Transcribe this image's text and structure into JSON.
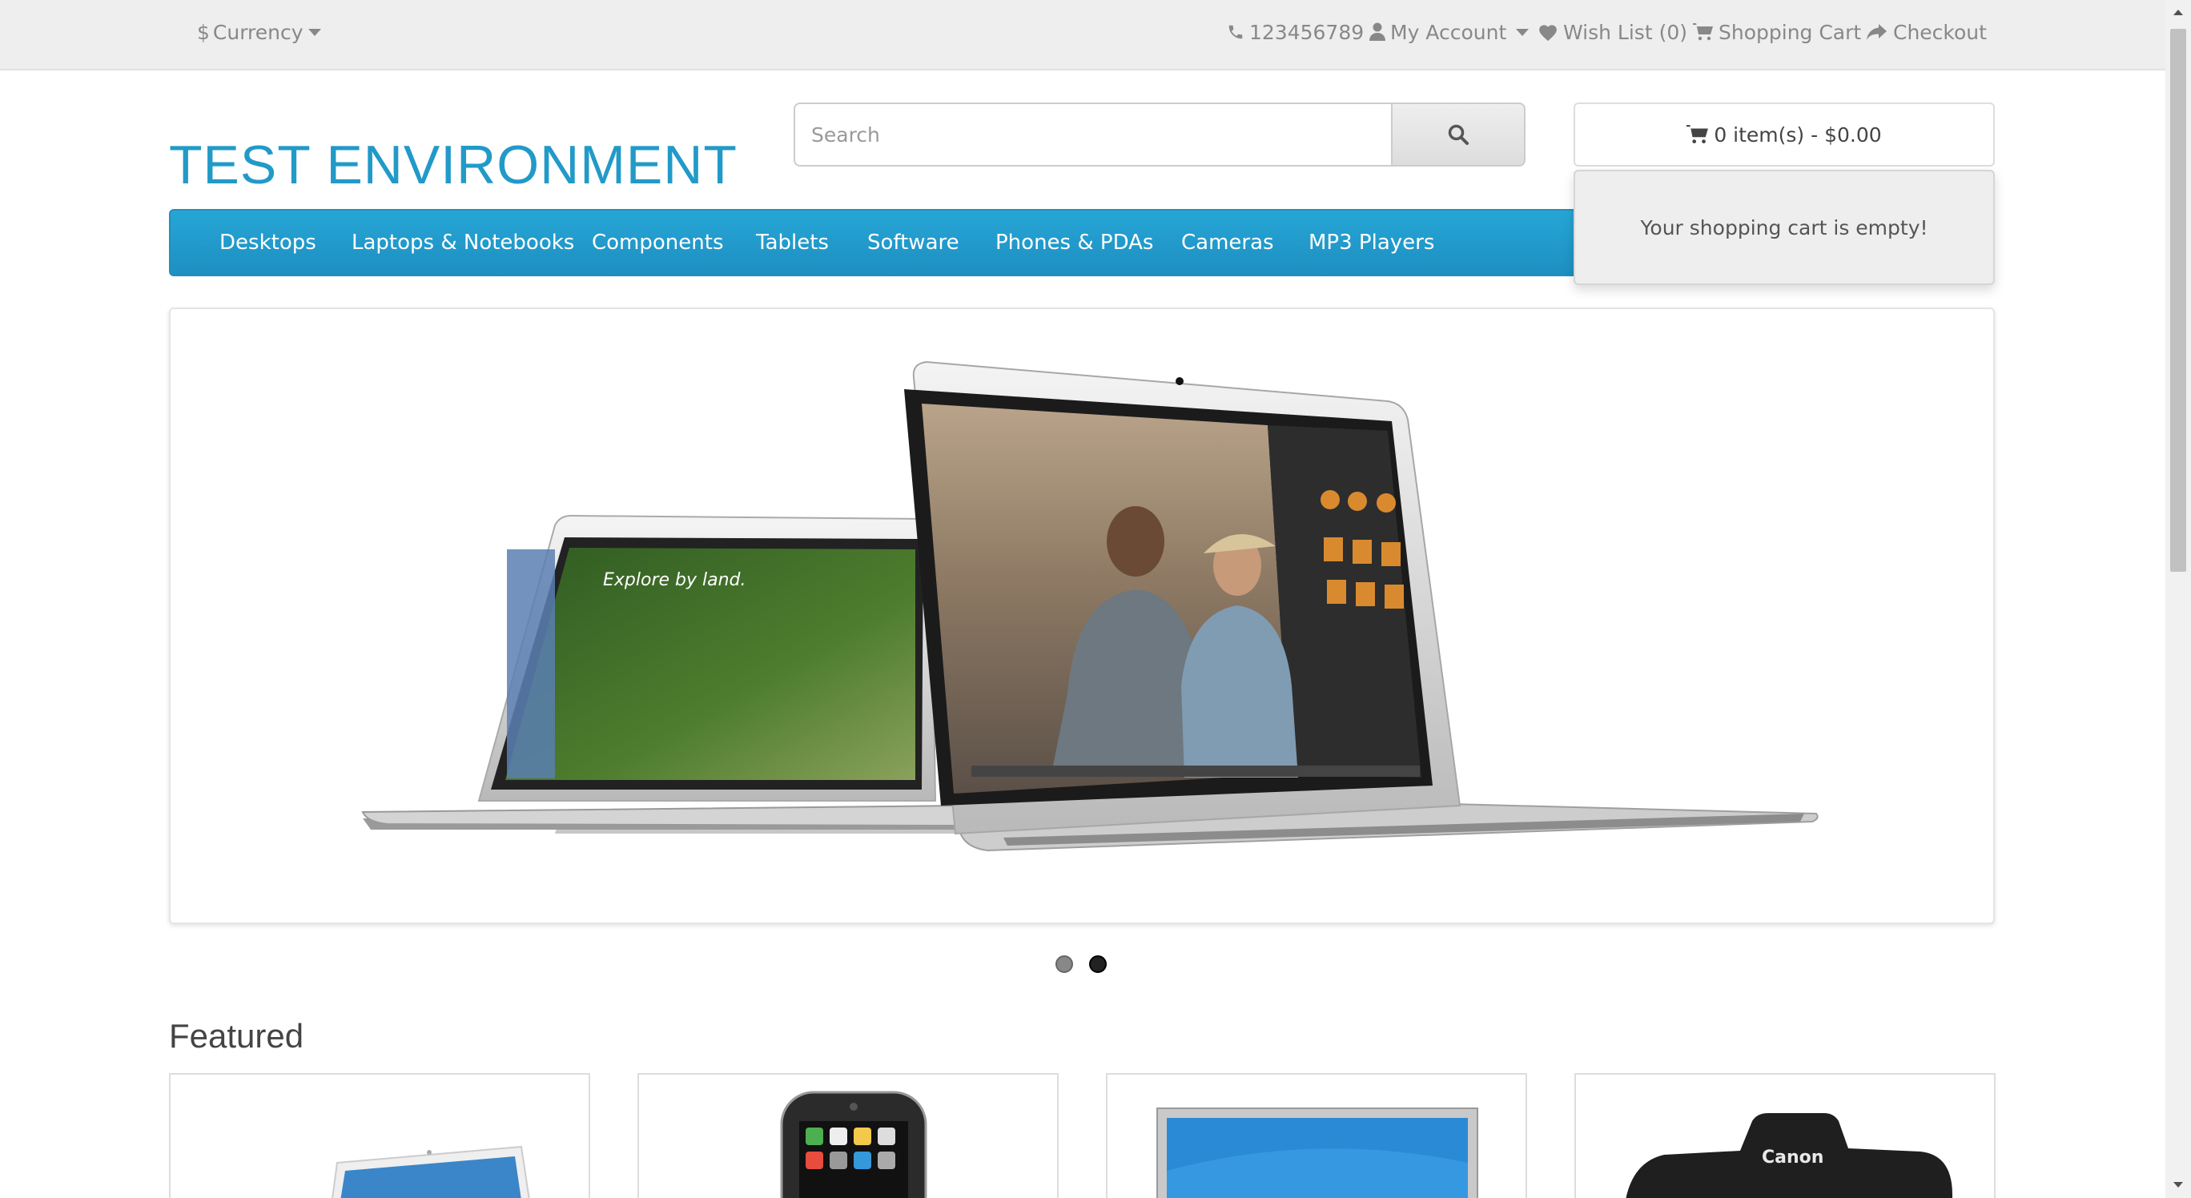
{
  "topbar": {
    "currency_label": "Currency",
    "phone": "123456789",
    "my_account": "My Account",
    "wishlist": "Wish List (0)",
    "shopping_cart": "Shopping Cart",
    "checkout": "Checkout"
  },
  "header": {
    "logo": "TEST ENVIRONMENT",
    "search_placeholder": "Search",
    "cart_summary": "0 item(s) - $0.00",
    "cart_empty_message": "Your shopping cart is empty!"
  },
  "menu": {
    "items": [
      "Desktops",
      "Laptops & Notebooks",
      "Components",
      "Tablets",
      "Software",
      "Phones & PDAs",
      "Cameras",
      "MP3 Players"
    ]
  },
  "slideshow": {
    "active_slide": 2,
    "slide_count": 2,
    "image_subject": "two MacBook Air laptops",
    "left_screen_text": "Explore by land."
  },
  "featured": {
    "heading": "Featured",
    "product_images": [
      "macbook-icon",
      "iphone-icon",
      "apple-cinema-display-icon",
      "canon-camera-icon"
    ],
    "camera_brand_text": "Canon"
  },
  "colors": {
    "brand": "#229ac8",
    "menu_bg": "#229ac8",
    "topbar_bg": "#eeeeee"
  }
}
